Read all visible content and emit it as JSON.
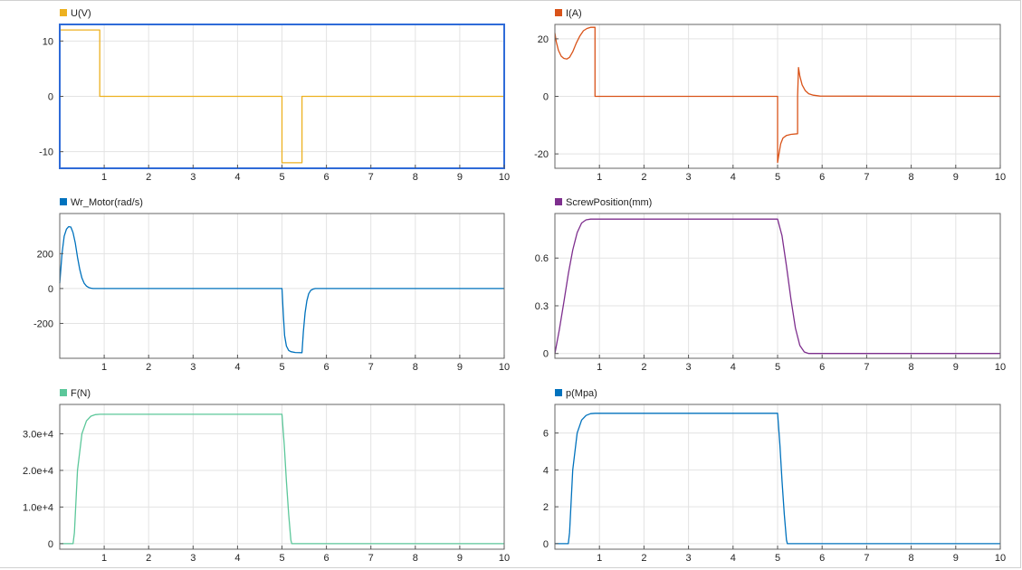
{
  "chart_data": [
    {
      "type": "line",
      "selected": true,
      "series": [
        {
          "name": "U(V)",
          "color": "#edb120",
          "x": [
            0,
            0.9,
            0.9,
            5.0,
            5.0,
            5.45,
            5.45,
            10
          ],
          "y": [
            12,
            12,
            0,
            0,
            -12,
            -12,
            0,
            0
          ]
        }
      ],
      "xlim": [
        0,
        10
      ],
      "ylim": [
        -13,
        13
      ],
      "xticks": [
        1,
        2,
        3,
        4,
        5,
        6,
        7,
        8,
        9,
        10
      ],
      "yticks": [
        -10,
        0,
        10
      ],
      "yticklabels": [
        "-10",
        "0",
        "10"
      ],
      "grid": true
    },
    {
      "type": "line",
      "series": [
        {
          "name": "I(A)",
          "color": "#d95319",
          "x": [
            0,
            0.03,
            0.08,
            0.14,
            0.2,
            0.27,
            0.33,
            0.4,
            0.48,
            0.56,
            0.64,
            0.72,
            0.8,
            0.9,
            0.9,
            5.0,
            5.0,
            5.03,
            5.07,
            5.12,
            5.2,
            5.3,
            5.45,
            5.45,
            5.47,
            5.5,
            5.55,
            5.62,
            5.7,
            5.8,
            5.95,
            10
          ],
          "y": [
            22,
            19,
            16,
            14,
            13.2,
            13,
            13.6,
            15.5,
            18.5,
            21,
            22.8,
            23.6,
            24,
            24,
            0,
            0,
            -23,
            -20,
            -16.5,
            -14.5,
            -13.6,
            -13.2,
            -13,
            0,
            10,
            7,
            4,
            2,
            0.9,
            0.4,
            0.1,
            0
          ]
        }
      ],
      "xlim": [
        0,
        10
      ],
      "ylim": [
        -25,
        25
      ],
      "xticks": [
        1,
        2,
        3,
        4,
        5,
        6,
        7,
        8,
        9,
        10
      ],
      "yticks": [
        -20,
        0,
        20
      ],
      "yticklabels": [
        "-20",
        "0",
        "20"
      ],
      "grid": true
    },
    {
      "type": "line",
      "series": [
        {
          "name": "Wr_Motor(rad/s)",
          "color": "#0072bd",
          "x": [
            0,
            0.05,
            0.1,
            0.15,
            0.2,
            0.25,
            0.3,
            0.35,
            0.4,
            0.45,
            0.5,
            0.55,
            0.6,
            0.65,
            0.7,
            0.75,
            0.8,
            0.85,
            0.9,
            1.0,
            5.0,
            5.03,
            5.06,
            5.1,
            5.15,
            5.2,
            5.3,
            5.45,
            5.48,
            5.52,
            5.56,
            5.6,
            5.65,
            5.7,
            5.75,
            5.85,
            10
          ],
          "y": [
            30,
            200,
            300,
            340,
            355,
            352,
            320,
            260,
            180,
            110,
            60,
            30,
            14,
            6,
            2,
            0,
            0,
            0,
            0,
            0,
            0,
            -150,
            -270,
            -330,
            -355,
            -362,
            -367,
            -368,
            -250,
            -140,
            -70,
            -30,
            -10,
            -3,
            0,
            0,
            0
          ]
        }
      ],
      "xlim": [
        0,
        10
      ],
      "ylim": [
        -400,
        430
      ],
      "xticks": [
        1,
        2,
        3,
        4,
        5,
        6,
        7,
        8,
        9,
        10
      ],
      "yticks": [
        -200,
        0,
        200
      ],
      "yticklabels": [
        "-200",
        "0",
        "200"
      ],
      "grid": true
    },
    {
      "type": "line",
      "series": [
        {
          "name": "ScrewPosition(mm)",
          "color": "#7e2f8e",
          "x": [
            0,
            0.1,
            0.2,
            0.3,
            0.4,
            0.5,
            0.6,
            0.7,
            0.8,
            0.9,
            1.0,
            5.0,
            5.1,
            5.2,
            5.3,
            5.4,
            5.5,
            5.6,
            5.7,
            5.8,
            10
          ],
          "y": [
            0,
            0.15,
            0.32,
            0.5,
            0.65,
            0.76,
            0.82,
            0.84,
            0.845,
            0.845,
            0.845,
            0.845,
            0.74,
            0.55,
            0.34,
            0.16,
            0.05,
            0.01,
            0,
            0,
            0
          ]
        }
      ],
      "xlim": [
        0,
        10
      ],
      "ylim": [
        -0.03,
        0.88
      ],
      "xticks": [
        1,
        2,
        3,
        4,
        5,
        6,
        7,
        8,
        9,
        10
      ],
      "yticks": [
        0,
        0.3,
        0.6
      ],
      "yticklabels": [
        "0",
        "0.3",
        "0.6"
      ],
      "grid": true
    },
    {
      "type": "line",
      "series": [
        {
          "name": "F(N)",
          "color": "#5cc79a",
          "x": [
            0,
            0.3,
            0.33,
            0.4,
            0.5,
            0.6,
            0.7,
            0.8,
            0.9,
            1.0,
            5.0,
            5.05,
            5.1,
            5.15,
            5.2,
            5.22,
            10
          ],
          "y": [
            0,
            0,
            3000,
            20000,
            30000,
            33500,
            34800,
            35200,
            35300,
            35300,
            35300,
            27000,
            17000,
            8000,
            1000,
            0,
            0
          ]
        }
      ],
      "xlim": [
        0,
        10
      ],
      "ylim": [
        -1500,
        38000
      ],
      "xticks": [
        1,
        2,
        3,
        4,
        5,
        6,
        7,
        8,
        9,
        10
      ],
      "yticks": [
        0,
        10000,
        20000,
        30000
      ],
      "yticklabels": [
        "0",
        "1.0e+4",
        "2.0e+4",
        "3.0e+4"
      ],
      "grid": true
    },
    {
      "type": "line",
      "series": [
        {
          "name": "p(Mpa)",
          "color": "#0072bd",
          "x": [
            0,
            0.3,
            0.33,
            0.4,
            0.5,
            0.6,
            0.7,
            0.8,
            0.9,
            1.0,
            5.0,
            5.05,
            5.1,
            5.15,
            5.2,
            5.22,
            10
          ],
          "y": [
            0,
            0,
            0.6,
            4,
            6,
            6.7,
            6.95,
            7.05,
            7.07,
            7.07,
            7.07,
            5.4,
            3.4,
            1.6,
            0.2,
            0,
            0
          ]
        }
      ],
      "xlim": [
        0,
        10
      ],
      "ylim": [
        -0.3,
        7.55
      ],
      "xticks": [
        1,
        2,
        3,
        4,
        5,
        6,
        7,
        8,
        9,
        10
      ],
      "yticks": [
        0,
        2,
        4,
        6
      ],
      "yticklabels": [
        "0",
        "2",
        "4",
        "6"
      ],
      "grid": true
    }
  ]
}
